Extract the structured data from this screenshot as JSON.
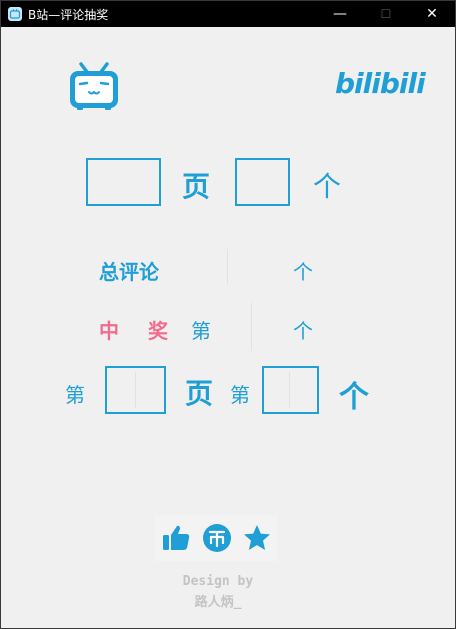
{
  "window": {
    "title": "B站—评论抽奖",
    "minimize": "—",
    "maximize": "☐",
    "close": "✕"
  },
  "brand": {
    "logo_text": "bilibili",
    "tv_icon": "bilibili-tv-icon"
  },
  "row1": {
    "page_input": "",
    "page_label": "页",
    "count_input": "",
    "count_label": "个"
  },
  "row2": {
    "label": "总评论",
    "value": "",
    "unit": "个"
  },
  "row3": {
    "label_zhong": "中",
    "label_jiang": "奖",
    "label_di": "第",
    "value": "",
    "unit": "个"
  },
  "row4": {
    "prefix_di": "第",
    "page_value": "",
    "page_label": "页",
    "item_di": "第",
    "item_value": "",
    "item_label": "个"
  },
  "actions": {
    "like_icon": "thumbs-up-icon",
    "coin_icon": "coin-icon",
    "fav_icon": "star-icon"
  },
  "credit": {
    "line1": "Design by",
    "line2": "路人炳_"
  },
  "colors": {
    "accent": "#1f9fd6",
    "pink": "#f36b8c",
    "background": "#f0f0f0"
  }
}
